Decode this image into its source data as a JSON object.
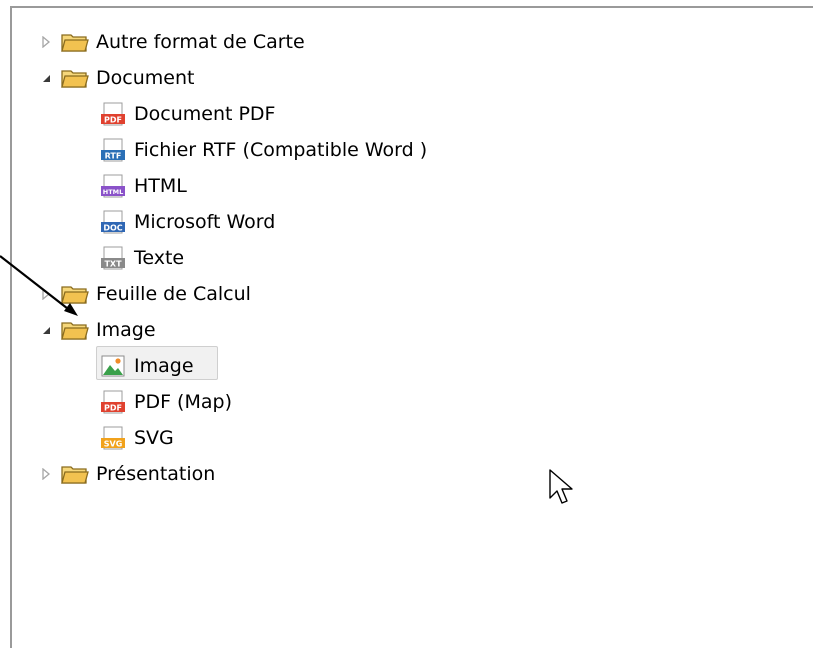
{
  "tree": {
    "items": [
      {
        "label": "Autre format de Carte",
        "expanded": false
      },
      {
        "label": "Document",
        "expanded": true,
        "children": [
          {
            "label": "Document PDF",
            "icon": "pdf-file-icon",
            "badge": "PDF"
          },
          {
            "label": "Fichier RTF (Compatible Word )",
            "icon": "rtf-file-icon",
            "badge": "RTF"
          },
          {
            "label": "HTML",
            "icon": "html-file-icon",
            "badge": "HTML"
          },
          {
            "label": "Microsoft Word",
            "icon": "doc-file-icon",
            "badge": "DOC"
          },
          {
            "label": "Texte",
            "icon": "txt-file-icon",
            "badge": "TXT"
          }
        ]
      },
      {
        "label": "Feuille de Calcul",
        "expanded": false
      },
      {
        "label": "Image",
        "expanded": true,
        "children": [
          {
            "label": "Image",
            "icon": "image-file-icon",
            "selected": true
          },
          {
            "label": "PDF (Map)",
            "icon": "pdf-file-icon",
            "badge": "PDF"
          },
          {
            "label": "SVG",
            "icon": "svg-file-icon",
            "badge": "SVG"
          }
        ]
      },
      {
        "label": "Présentation",
        "expanded": false
      }
    ]
  },
  "colors": {
    "pdf": "#e0412f",
    "rtf": "#2a6fb6",
    "html": "#8a52c9",
    "doc": "#2f67b4",
    "txt": "#8a8a8a",
    "svg": "#f1a21c",
    "folder": "#e8b73e"
  }
}
